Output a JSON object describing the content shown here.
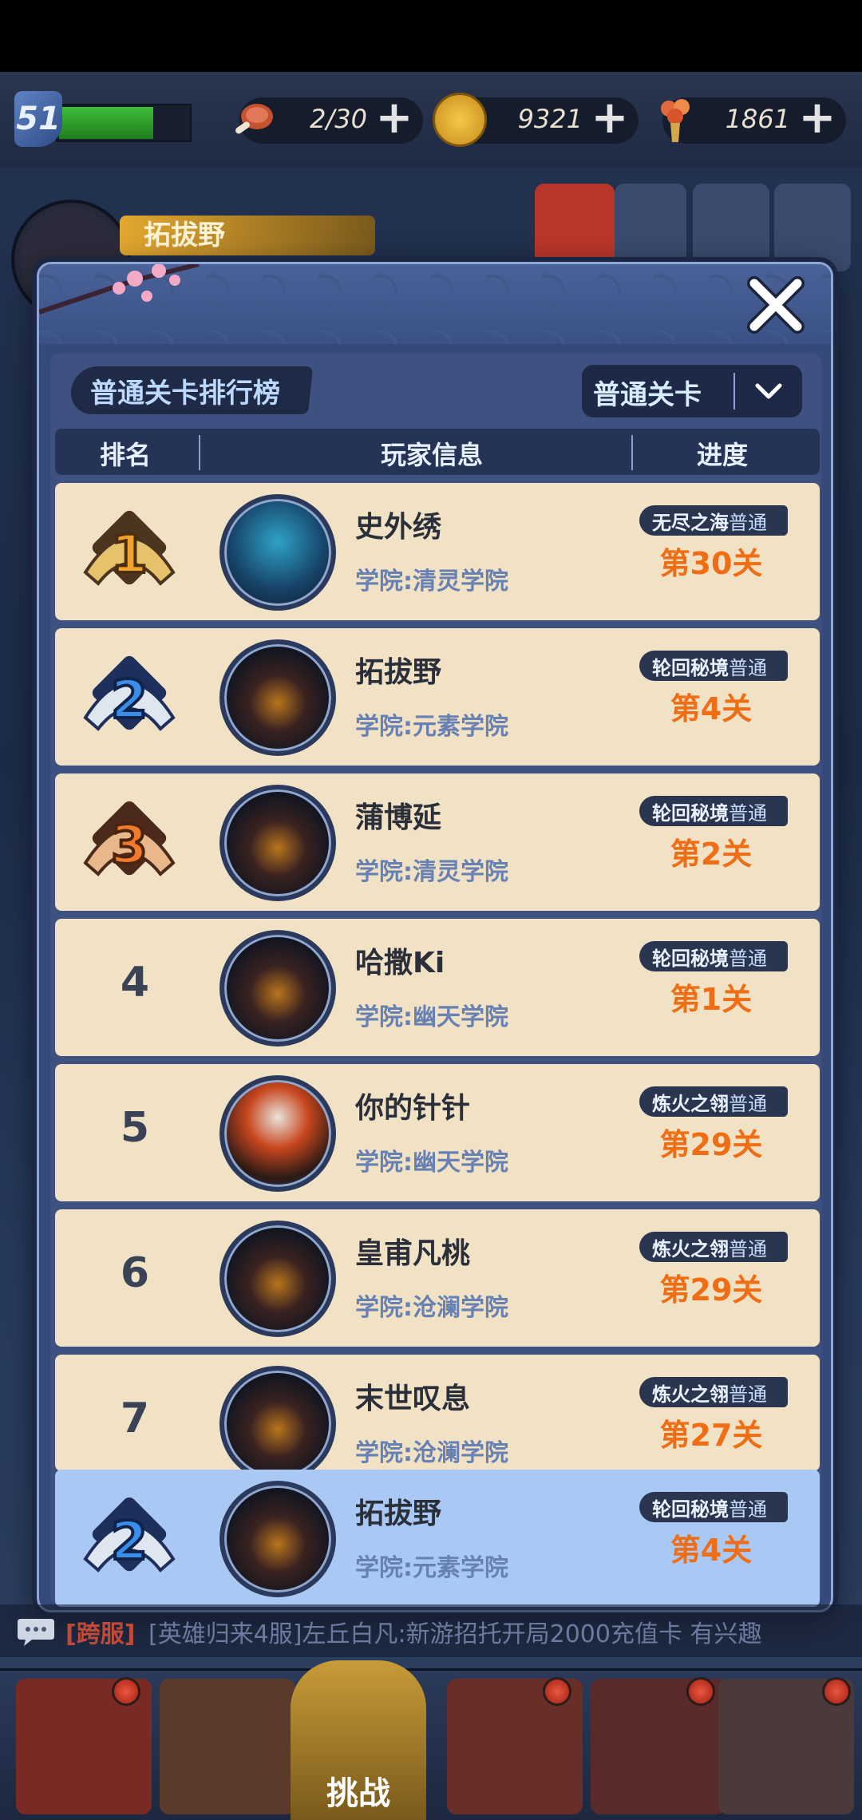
{
  "status": {
    "level": "51",
    "stamina": "2/30",
    "gold": "9321",
    "gems": "1861"
  },
  "profile": {
    "name": "拓拔野"
  },
  "leaderboard": {
    "title": "普通关卡排行榜",
    "filter": "普通关卡",
    "headers": {
      "rank": "排名",
      "player": "玩家信息",
      "progress": "进度"
    },
    "rows": [
      {
        "rank": "1",
        "name": "史外绣",
        "school": "学院:清灵学院",
        "map": "无尽之海",
        "mode": "普通",
        "stage": "第30关"
      },
      {
        "rank": "2",
        "name": "拓拔野",
        "school": "学院:元素学院",
        "map": "轮回秘境",
        "mode": "普通",
        "stage": "第4关"
      },
      {
        "rank": "3",
        "name": "蒲博延",
        "school": "学院:清灵学院",
        "map": "轮回秘境",
        "mode": "普通",
        "stage": "第2关"
      },
      {
        "rank": "4",
        "name": "哈撒Ki",
        "school": "学院:幽天学院",
        "map": "轮回秘境",
        "mode": "普通",
        "stage": "第1关"
      },
      {
        "rank": "5",
        "name": "你的针针",
        "school": "学院:幽天学院",
        "map": "炼火之翎",
        "mode": "普通",
        "stage": "第29关"
      },
      {
        "rank": "6",
        "name": "皇甫凡桃",
        "school": "学院:沧澜学院",
        "map": "炼火之翎",
        "mode": "普通",
        "stage": "第29关"
      },
      {
        "rank": "7",
        "name": "末世叹息",
        "school": "学院:沧澜学院",
        "map": "炼火之翎",
        "mode": "普通",
        "stage": "第27关"
      }
    ],
    "me": {
      "rank": "2",
      "name": "拓拔野",
      "school": "学院:元素学院",
      "map": "轮回秘境",
      "mode": "普通",
      "stage": "第4关"
    }
  },
  "chat": {
    "channel": "[跨服]",
    "message": "[英雄归来4服]左丘白凡:新游招托开局2000充值卡 有兴趣"
  },
  "bottom_nav": {
    "challenge_label": "挑战"
  },
  "colors": {
    "stage_orange": "#ef6d14",
    "row_bg": "#f1e2c6",
    "me_row_bg": "#a9c9f4",
    "modal_blue": "#364a7a"
  },
  "icons": [
    "meat-icon",
    "coin-icon",
    "gem-bundle-icon",
    "close-icon",
    "chevron-down-icon",
    "chat-bubble-icon",
    "rank-medal-icon"
  ]
}
